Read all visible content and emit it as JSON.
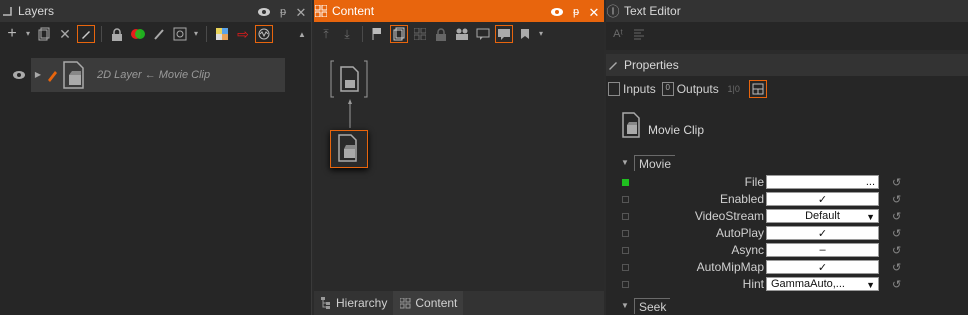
{
  "layers": {
    "title": "Layers",
    "row": {
      "label": "2D Layer ← Movie Clip"
    }
  },
  "content": {
    "title": "Content",
    "tabs": [
      {
        "label": "Hierarchy"
      },
      {
        "label": "Content"
      }
    ]
  },
  "text_editor": {
    "title": "Text Editor"
  },
  "properties": {
    "title": "Properties",
    "tabs": [
      {
        "label": "Inputs"
      },
      {
        "label": "Outputs"
      }
    ],
    "object_name": "Movie Clip",
    "sections": [
      {
        "label": "Movie"
      },
      {
        "label": "Seek"
      }
    ],
    "rows": [
      {
        "label": "File",
        "value": "...",
        "active": true
      },
      {
        "label": "Enabled",
        "value": "✓"
      },
      {
        "label": "VideoStream",
        "value": "Default"
      },
      {
        "label": "AutoPlay",
        "value": "✓"
      },
      {
        "label": "Async",
        "value": "–"
      },
      {
        "label": "AutoMipMap",
        "value": "✓"
      },
      {
        "label": "Hint",
        "value": "GammaAuto,..."
      }
    ]
  },
  "colors": {
    "accent": "#e8650d",
    "active_indicator": "#1fbf1f",
    "panel_bg": "#262626"
  }
}
